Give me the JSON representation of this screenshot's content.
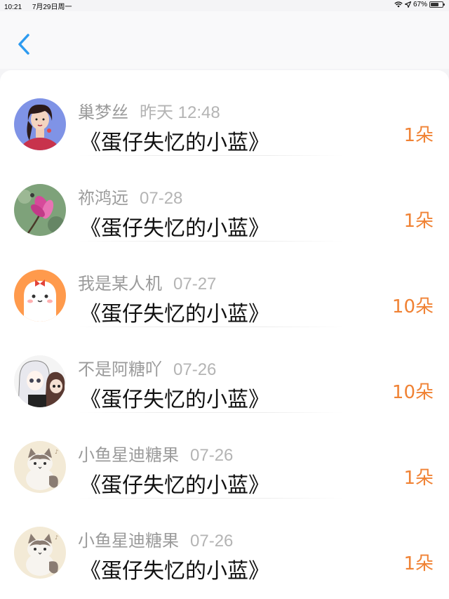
{
  "status_bar": {
    "time": "10:21",
    "date": "7月29日周一",
    "battery": "67%",
    "battery_level": 0.67,
    "icons": [
      "wifi-icon",
      "location-icon",
      "battery-icon"
    ]
  },
  "header": {
    "back_icon": "chevron-left-icon",
    "accent_color": "#2d9bf0"
  },
  "colors": {
    "count": "#f08234",
    "name": "#9b9b9b",
    "title": "#111111"
  },
  "list": [
    {
      "name": "巢梦丝",
      "time": "昨天 12:48",
      "title": "《蛋仔失忆的小蓝》",
      "count": "1朵",
      "avatar": "girl-portrait"
    },
    {
      "name": "祢鸿远",
      "time": "07-28",
      "title": "《蛋仔失忆的小蓝》",
      "count": "1朵",
      "avatar": "pink-flower"
    },
    {
      "name": "我是某人机",
      "time": "07-27",
      "title": "《蛋仔失忆的小蓝》",
      "count": "10朵",
      "avatar": "cartoon-ghost"
    },
    {
      "name": "不是阿糖吖",
      "time": "07-26",
      "title": "《蛋仔失忆的小蓝》",
      "count": "10朵",
      "avatar": "anime-characters"
    },
    {
      "name": "小鱼星迪糖果",
      "time": "07-26",
      "title": "《蛋仔失忆的小蓝》",
      "count": "1朵",
      "avatar": "cartoon-cat"
    },
    {
      "name": "小鱼星迪糖果",
      "time": "07-26",
      "title": "《蛋仔失忆的小蓝》",
      "count": "1朵",
      "avatar": "cartoon-cat"
    }
  ]
}
